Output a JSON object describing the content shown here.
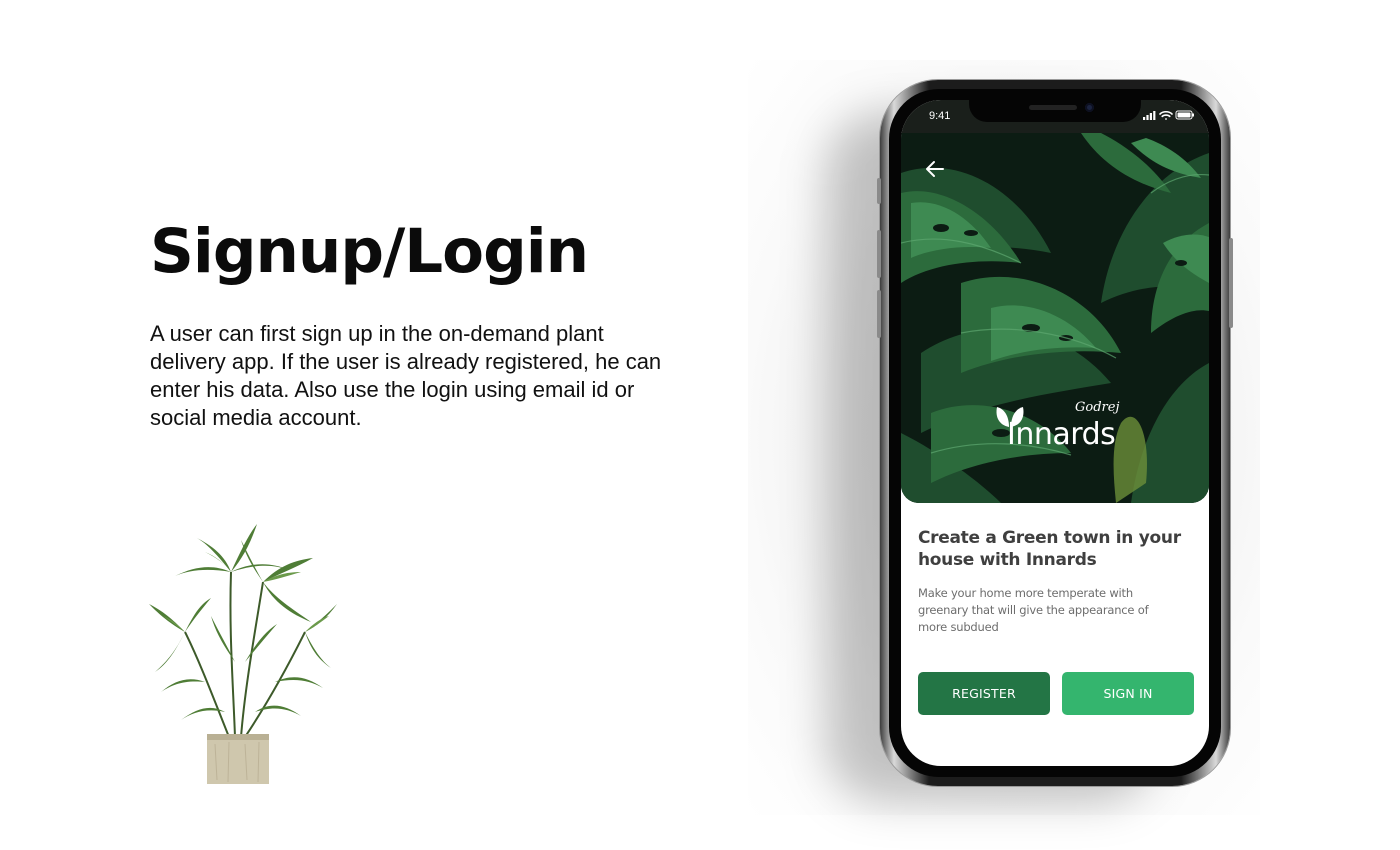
{
  "slide": {
    "heading": "Signup/Login",
    "description": "A user can first sign up in the on-demand plant delivery app. If the user is already registered, he can enter his data. Also use the login using email id or social media account."
  },
  "phone": {
    "status_bar": {
      "time": "9:41"
    },
    "brand": {
      "parent": "Godrej",
      "name": "Innards"
    },
    "title": "Create a Green town in your house with Innards",
    "subtitle": "Make your home more temperate with greenary that will give the appearance of more subdued",
    "buttons": {
      "register": "REGISTER",
      "sign_in": "SIGN IN"
    }
  },
  "colors": {
    "register_button": "#237545",
    "sign_in_button": "#34b56e",
    "hero_background": "#0b1a12"
  },
  "icons": {
    "back": "arrow-left-icon",
    "signal": "cellular-signal-icon",
    "wifi": "wifi-icon",
    "battery": "battery-icon"
  }
}
